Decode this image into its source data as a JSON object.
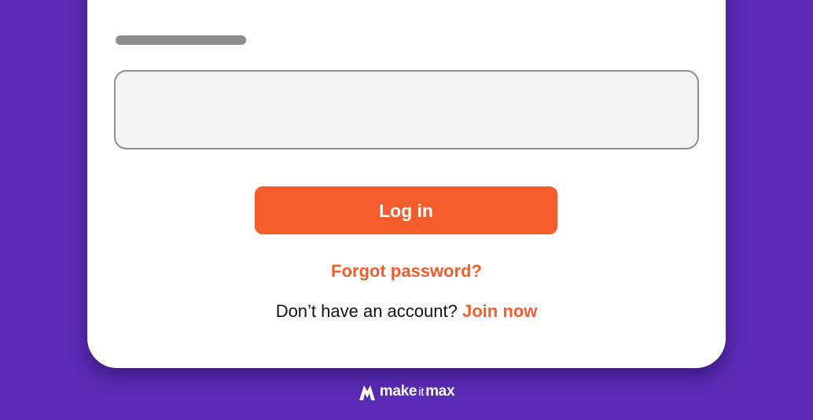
{
  "login": {
    "password_value": "",
    "login_button_label": "Log in",
    "forgot_password_label": "Forgot password?",
    "no_account_text": "Don’t have an account?",
    "join_now_label": "Join now"
  },
  "brand": {
    "name_part1": "make",
    "name_part2": "it",
    "name_part3": "max"
  },
  "colors": {
    "background": "#5b2ab5",
    "accent": "#f45d2b",
    "card": "#ffffff",
    "input_fill": "#f3f3f3",
    "input_border": "#8e8e8e"
  },
  "icons": {
    "brand_logo": "mountain-m-logo-icon"
  }
}
